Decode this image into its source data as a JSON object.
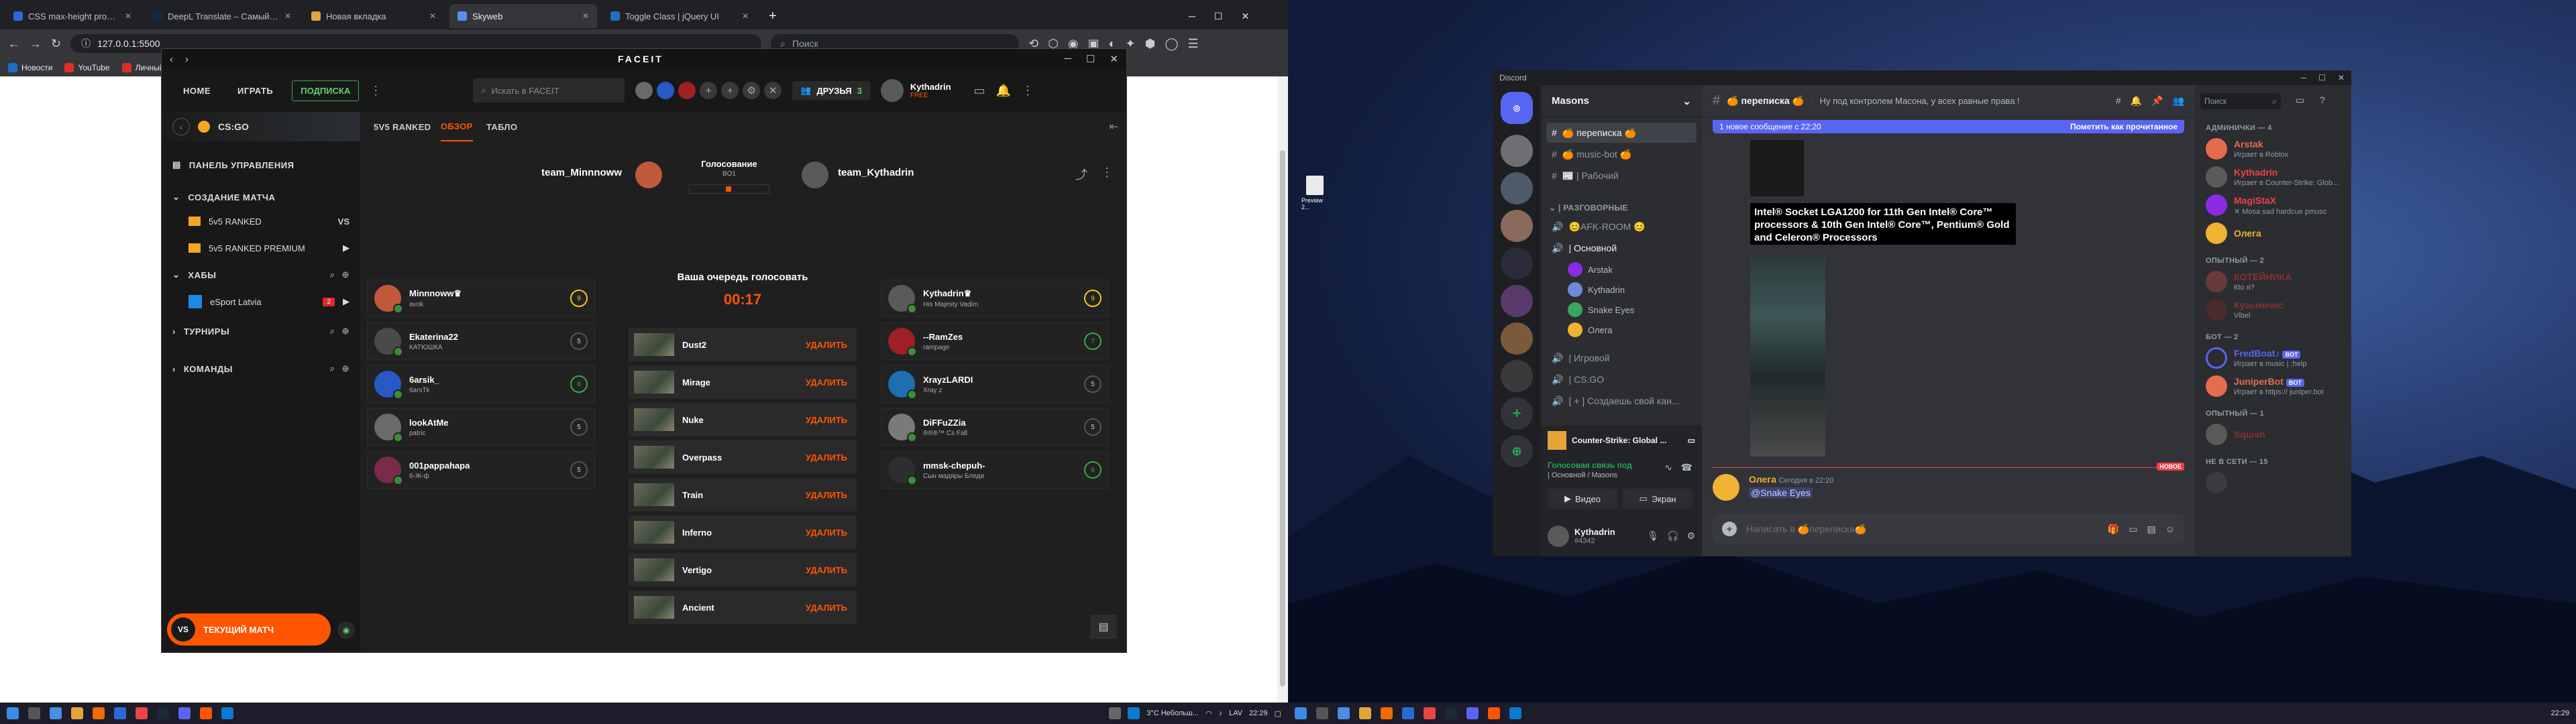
{
  "browser": {
    "tabs": [
      {
        "title": "CSS max-height property",
        "color": "#2a6ad8"
      },
      {
        "title": "DeepL Translate – Самый точн...",
        "color": "#0f2b46"
      },
      {
        "title": "Новая вкладка",
        "color": "#e8a33d"
      },
      {
        "title": "Skyweb",
        "color": "#5b8def"
      },
      {
        "title": "Toggle Class | jQuery UI",
        "color": "#1e6fbf"
      }
    ],
    "address": "127.0.0.1:5500",
    "search_placeholder": "Поиск",
    "bookmarks": [
      "Новости",
      "YouTube",
      "Личный"
    ]
  },
  "faceit": {
    "logo": "FACEIT",
    "nav": {
      "home": "НОМЕ",
      "play": "ИГРАТЬ",
      "subscription": "ПОДПИСКА"
    },
    "search_placeholder": "Искать в FACEIT",
    "friends_label": "ДРУЗЬЯ",
    "friends_count": "3",
    "user": {
      "name": "Kythadrin",
      "status": "FREE"
    },
    "game": "CS:GO",
    "sidebar": {
      "control_panel": "ПАНЕЛЬ УПРАВЛЕНИЯ",
      "create_match": "СОЗДАНИЕ МАТЧА",
      "ranked": "5v5 RANKED",
      "ranked_premium": "5v5 RANKED PREMIUM",
      "vs": "VS",
      "hubs": "ХАБЫ",
      "hub_item": "eSport Latvia",
      "hub_badge": "2",
      "tournaments": "ТУРНИРЫ",
      "teams": "КОМАНДЫ",
      "current_match": "ТЕКУЩИЙ МАТЧ",
      "vs_badge": "VS"
    },
    "tabs": [
      "5V5 RANKED",
      "ОБЗОР",
      "ТАБЛО"
    ],
    "match": {
      "team_a": "team_Minnnoww",
      "team_b": "team_Kythadrin",
      "phase": "Голосование",
      "format": "BO1",
      "your_turn": "Ваша очередь голосовать",
      "timer": "00:17"
    },
    "team_a_players": [
      {
        "name": "Minnnoww♛",
        "sub": "avok",
        "elo": "9",
        "color": "#c0593a",
        "elo_class": "gold"
      },
      {
        "name": "Ekaterina22",
        "sub": "КАТЮШКА",
        "elo": "5",
        "color": "#4a4a4a",
        "elo_class": ""
      },
      {
        "name": "6arsik_",
        "sub": "6arsTk",
        "elo": "6",
        "color": "#2a58c6",
        "elo_class": "grn"
      },
      {
        "name": "lookAtMe",
        "sub": "patric",
        "elo": "5",
        "color": "#6a6a6a",
        "elo_class": ""
      },
      {
        "name": "001pappahapa",
        "sub": "б-Ж-ф",
        "elo": "5",
        "color": "#7a2a4a",
        "elo_class": ""
      }
    ],
    "team_b_players": [
      {
        "name": "Kythadrin♛",
        "sub": "His Majesty Vadim",
        "elo": "9",
        "color": "#5a5a5a",
        "elo_class": "gold"
      },
      {
        "name": "--RamZes",
        "sub": "rampage",
        "elo": "7",
        "color": "#a01f24",
        "elo_class": "grn"
      },
      {
        "name": "XrayzLARDI",
        "sub": "Xray z",
        "elo": "5",
        "color": "#1f6fb0",
        "elo_class": ""
      },
      {
        "name": "DiFFuZZia",
        "sub": "®®®™ Cs Fall",
        "elo": "5",
        "color": "#7a7a7a",
        "elo_class": ""
      },
      {
        "name": "mmsk-chepuh-",
        "sub": "Сын мадяры Бледи",
        "elo": "6",
        "color": "#2e2e2e",
        "elo_class": "grn"
      }
    ],
    "maps": [
      "Dust2",
      "Mirage",
      "Nuke",
      "Overpass",
      "Train",
      "Inferno",
      "Vertigo",
      "Ancient"
    ],
    "remove_label": "УДАЛИТЬ"
  },
  "taskbar_left": {
    "weather": "3°C  Небольш...",
    "lang": "LAV",
    "time": "22:29"
  },
  "desktop_icon": "Preview 2...",
  "discord": {
    "window_title": "Discord",
    "server": "Masons",
    "channel": "🍊 переписка 🍊",
    "topic": "Ну под контролем Масона, у всех равные права !",
    "new_messages": "1 новое сообщение с 22:20",
    "mark_read": "Пометить как прочитанное",
    "channels": [
      {
        "name": "🍊 переписка 🍊",
        "type": "text",
        "selected": true
      },
      {
        "name": "🍊 music-bot 🍊",
        "type": "text",
        "selected": false
      },
      {
        "name": "📰 | Рабочий",
        "type": "text",
        "selected": false
      }
    ],
    "voice_category": "| РАЗГОВОРНЫЕ",
    "voice_channels": [
      {
        "name": "😊AFK-ROOM 😊"
      },
      {
        "name": "| Основной"
      }
    ],
    "voice_users": [
      {
        "name": "Arstak",
        "color": "#8a2be2"
      },
      {
        "name": "Kythadrin",
        "color": "#7289da"
      },
      {
        "name": "Snake Eyes",
        "color": "#3ba55d"
      },
      {
        "name": "Олега",
        "color": "#f0b232"
      }
    ],
    "more_channels": [
      "| Игровой",
      "| CS:GO",
      "[ + ] Создаешь свой кан..."
    ],
    "activity": "Counter-Strike: Global ...",
    "voice_connected": "Голосовая связь под",
    "voice_where": "| Основной / Masons",
    "video_btn": "Видео",
    "screen_btn": "Экран",
    "me": {
      "name": "Kythadrin",
      "tag": "#4342"
    },
    "message_text": "Intel® Socket LGA1200 for 11th Gen Intel® Core™ processors & 10th Gen Intel® Core™, Pentium® Gold and Celeron® Processors",
    "new_divider": "НОВОЕ",
    "last_author": "Олега",
    "last_time": "Сегодня в 22:20",
    "last_mention": "@Snake Eyes",
    "input_placeholder": "Написать в 🍊переписка🍊",
    "members_search": "Поиск",
    "member_groups": [
      {
        "title": "АДМИНИЧКИ — 4",
        "members": [
          {
            "name": "Arstak",
            "status": "Играет в Roblox",
            "color": "#e56c4e",
            "bot": false
          },
          {
            "name": "Kythadrin",
            "status": "Играет в Counter-Strike: Glob...",
            "color": "#ed4245",
            "bot": false
          },
          {
            "name": "MagiStaX",
            "status": "✕ Mosa sad hardcue pmusc",
            "color": "#ed4245",
            "bot": false
          },
          {
            "name": "Олега",
            "status": "",
            "color": "#f0b232",
            "bot": false
          }
        ]
      },
      {
        "title": "ОПЫТНЫЙ — 2",
        "members": [
          {
            "name": "КОТЕЙНИКА",
            "status": "Кto я?",
            "color": "#8a2f2f",
            "bot": false
          },
          {
            "name": "Кузьмичес",
            "status": "Vibel",
            "color": "#8a2f2f",
            "bot": false
          }
        ]
      },
      {
        "title": "БОТ — 2",
        "members": [
          {
            "name": "FredBoat♪",
            "status": "Играет в music | ;help",
            "color": "#5865f2",
            "bot": true
          },
          {
            "name": "JuniperBot",
            "status": "Играет в https:// juniper.bot",
            "color": "#e56c4e",
            "bot": true
          }
        ]
      },
      {
        "title": "ОПЫТНЫЙ — 1",
        "members": [
          {
            "name": "Squish",
            "status": "",
            "color": "#8a2f2f",
            "bot": false
          }
        ]
      }
    ],
    "offline_title": "НЕ В СЕТИ — 15",
    "bot_label": "BOT"
  },
  "taskbar_right": {
    "time": "22:29"
  }
}
